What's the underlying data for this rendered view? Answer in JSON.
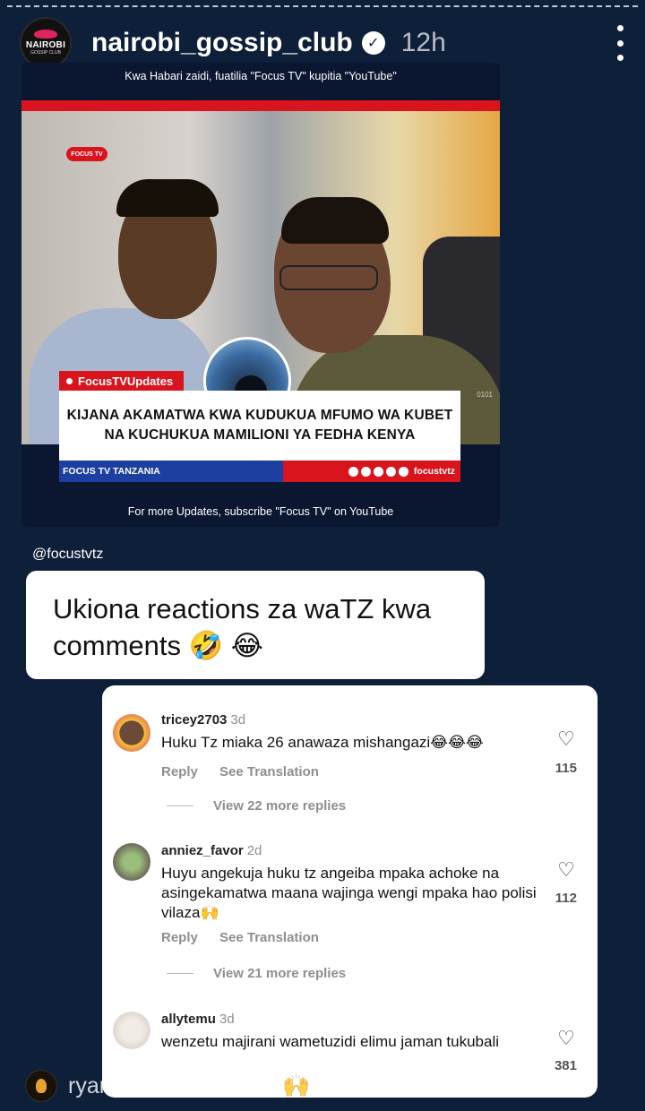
{
  "story": {
    "username": "nairobi_gossip_club",
    "time": "12h",
    "avatar_line1": "NAIROBI",
    "avatar_line2": "GOSSIP CLUB"
  },
  "media": {
    "top_caption": "Kwa Habari zaidi, fuatilia \"Focus TV\" kupitia \"YouTube\"",
    "logo": "FOCUS TV",
    "tag": "FocusTVUpdates",
    "headline": "KIJANA AKAMATWA KWA KUDUKUA MFUMO WA KUBET NA KUCHUKUA MAMILIONI YA FEDHA KENYA",
    "code": "0101",
    "bar_left": "FOCUS TV TANZANIA",
    "bar_right": "focustvtz",
    "bottom_caption": "For more Updates, subscribe \"Focus TV\" on YouTube"
  },
  "mention": "@focustvtz",
  "caption": "Ukiona reactions za waTZ kwa comments 🤣 😂",
  "comments": [
    {
      "user": "tricey2703",
      "age": "3d",
      "text": "Huku Tz miaka 26 anawaza mishangazi😂😂😂",
      "reply": "Reply",
      "translate": "See Translation",
      "likes": "115",
      "view_replies": "View 22 more replies"
    },
    {
      "user": "anniez_favor",
      "age": "2d",
      "text": "Huyu angekuja huku tz angeiba mpaka achoke na asingekamatwa maana wajinga wengi mpaka hao polisi vilaza🙌",
      "reply": "Reply",
      "translate": "See Translation",
      "likes": "112",
      "view_replies": "View 21 more replies"
    },
    {
      "user": "allytemu",
      "age": "3d",
      "text": "wenzetu majirani wametuzidi elimu jaman tukubali",
      "likes": "381"
    }
  ],
  "footer": {
    "text": "ryanna_marlene😂😂🙌waah"
  },
  "colors": {
    "background": "#0e1f3a",
    "accent_red": "#d9141d",
    "accent_blue": "#1d3fa0"
  }
}
